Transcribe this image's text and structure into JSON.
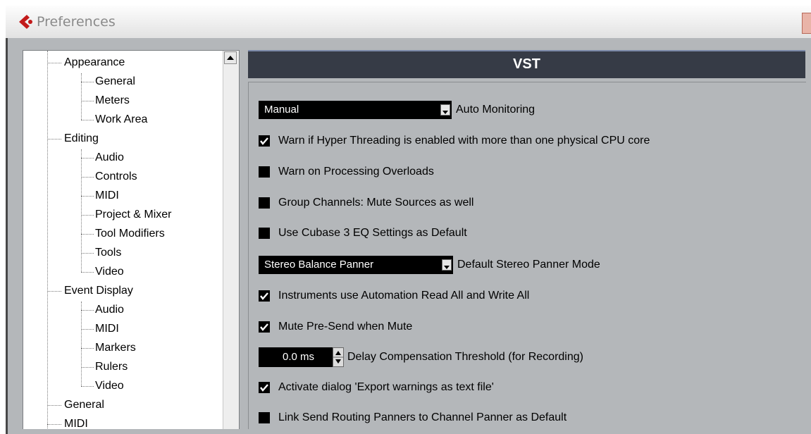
{
  "window": {
    "title": "Preferences"
  },
  "panel": {
    "title": "VST"
  },
  "tree": {
    "items": [
      {
        "label": "Appearance",
        "level": 0
      },
      {
        "label": "General",
        "level": 1
      },
      {
        "label": "Meters",
        "level": 1
      },
      {
        "label": "Work Area",
        "level": 1
      },
      {
        "label": "Editing",
        "level": 0
      },
      {
        "label": "Audio",
        "level": 1
      },
      {
        "label": "Controls",
        "level": 1
      },
      {
        "label": "MIDI",
        "level": 1
      },
      {
        "label": "Project & Mixer",
        "level": 1
      },
      {
        "label": "Tool Modifiers",
        "level": 1
      },
      {
        "label": "Tools",
        "level": 1
      },
      {
        "label": "Video",
        "level": 1
      },
      {
        "label": "Event Display",
        "level": 0
      },
      {
        "label": "Audio",
        "level": 1
      },
      {
        "label": "MIDI",
        "level": 1
      },
      {
        "label": "Markers",
        "level": 1
      },
      {
        "label": "Rulers",
        "level": 1
      },
      {
        "label": "Video",
        "level": 1
      },
      {
        "label": "General",
        "level": 0
      },
      {
        "label": "MIDI",
        "level": 0
      }
    ]
  },
  "settings": {
    "auto_monitoring": {
      "value": "Manual",
      "label": "Auto Monitoring"
    },
    "warn_hyper_threading": {
      "checked": true,
      "label": "Warn if Hyper Threading is enabled with more than one physical CPU core"
    },
    "warn_overloads": {
      "checked": false,
      "label": "Warn on Processing Overloads"
    },
    "group_channels_mute": {
      "checked": false,
      "label": "Group Channels: Mute Sources as well"
    },
    "cubase3_eq": {
      "checked": false,
      "label": "Use Cubase 3 EQ Settings as Default"
    },
    "stereo_panner": {
      "value": "Stereo Balance Panner",
      "label": "Default Stereo Panner Mode"
    },
    "instruments_automation": {
      "checked": true,
      "label": "Instruments use Automation Read All and Write All"
    },
    "mute_pre_send": {
      "checked": true,
      "label": "Mute Pre-Send when Mute"
    },
    "delay_compensation": {
      "value": "0.0 ms",
      "label": "Delay Compensation Threshold (for Recording)"
    },
    "export_warnings": {
      "checked": true,
      "label": "Activate dialog 'Export warnings as text file'"
    },
    "link_send_routing": {
      "checked": false,
      "label": "Link Send Routing Panners to Channel Panner as Default"
    }
  },
  "colors": {
    "header_bg": "#363b46",
    "panel_bg": "#b4b7ba",
    "logo_red": "#c21a1a"
  },
  "icons": {
    "app": "cubase-logo-icon",
    "close": "close-icon",
    "scroll_up": "scroll-up-arrow-icon"
  }
}
